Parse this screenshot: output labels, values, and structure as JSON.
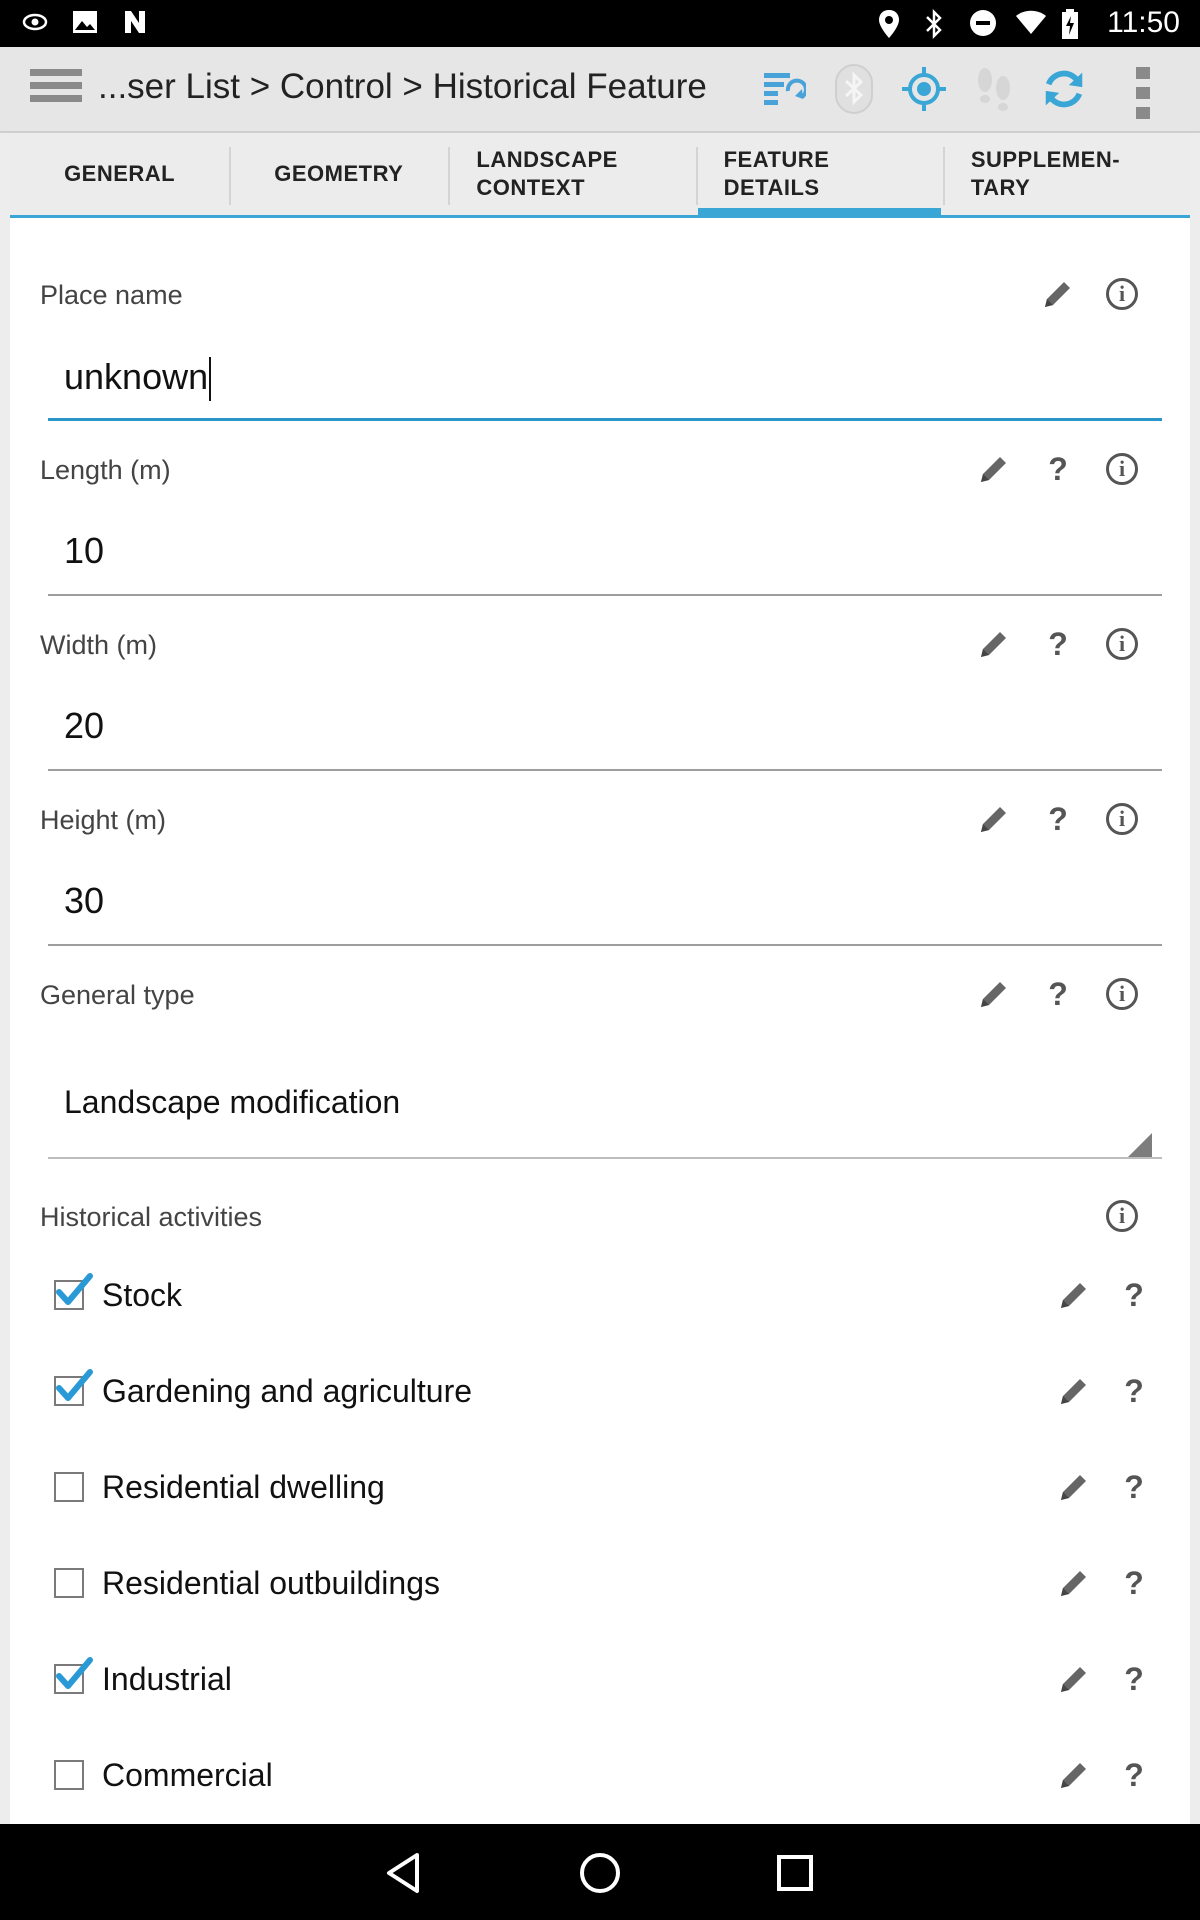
{
  "status_bar": {
    "time": "11:50",
    "left_icons": [
      "eye-icon",
      "image-icon",
      "n-logo-icon"
    ],
    "right_icons": [
      "location-pin-icon",
      "bluetooth-icon",
      "do-not-disturb-icon",
      "wifi-icon",
      "battery-charging-icon"
    ]
  },
  "action_bar": {
    "title": "...ser List > Control > Historical Feature",
    "icons": [
      "sync-list-icon",
      "bluetooth-disabled-icon",
      "gps-target-icon",
      "footsteps-icon",
      "refresh-icon",
      "overflow-menu-icon"
    ]
  },
  "tabs": [
    {
      "label": "GENERAL",
      "active": false
    },
    {
      "label": "GEOMETRY",
      "active": false
    },
    {
      "label": "LANDSCAPE CONTEXT",
      "active": false
    },
    {
      "label": "FEATURE DETAILS",
      "active": true
    },
    {
      "label": "SUPPLEMEN-TARY",
      "active": false
    }
  ],
  "fields": {
    "place_name": {
      "label": "Place name",
      "value": "unknown"
    },
    "length": {
      "label": "Length (m)",
      "value": "10"
    },
    "width": {
      "label": "Width (m)",
      "value": "20"
    },
    "height": {
      "label": "Height (m)",
      "value": "30"
    },
    "general_type": {
      "label": "General type",
      "value": "Landscape modification"
    }
  },
  "historical_activities": {
    "label": "Historical activities",
    "items": [
      {
        "label": "Stock",
        "checked": true
      },
      {
        "label": "Gardening and agriculture",
        "checked": true
      },
      {
        "label": "Residential dwelling",
        "checked": false
      },
      {
        "label": "Residential outbuildings",
        "checked": false
      },
      {
        "label": "Industrial",
        "checked": true
      },
      {
        "label": "Commercial",
        "checked": false
      }
    ]
  },
  "colors": {
    "accent": "#3aa6d6",
    "focus_underline": "#2a95c8",
    "check_blue": "#2a9ad6"
  }
}
